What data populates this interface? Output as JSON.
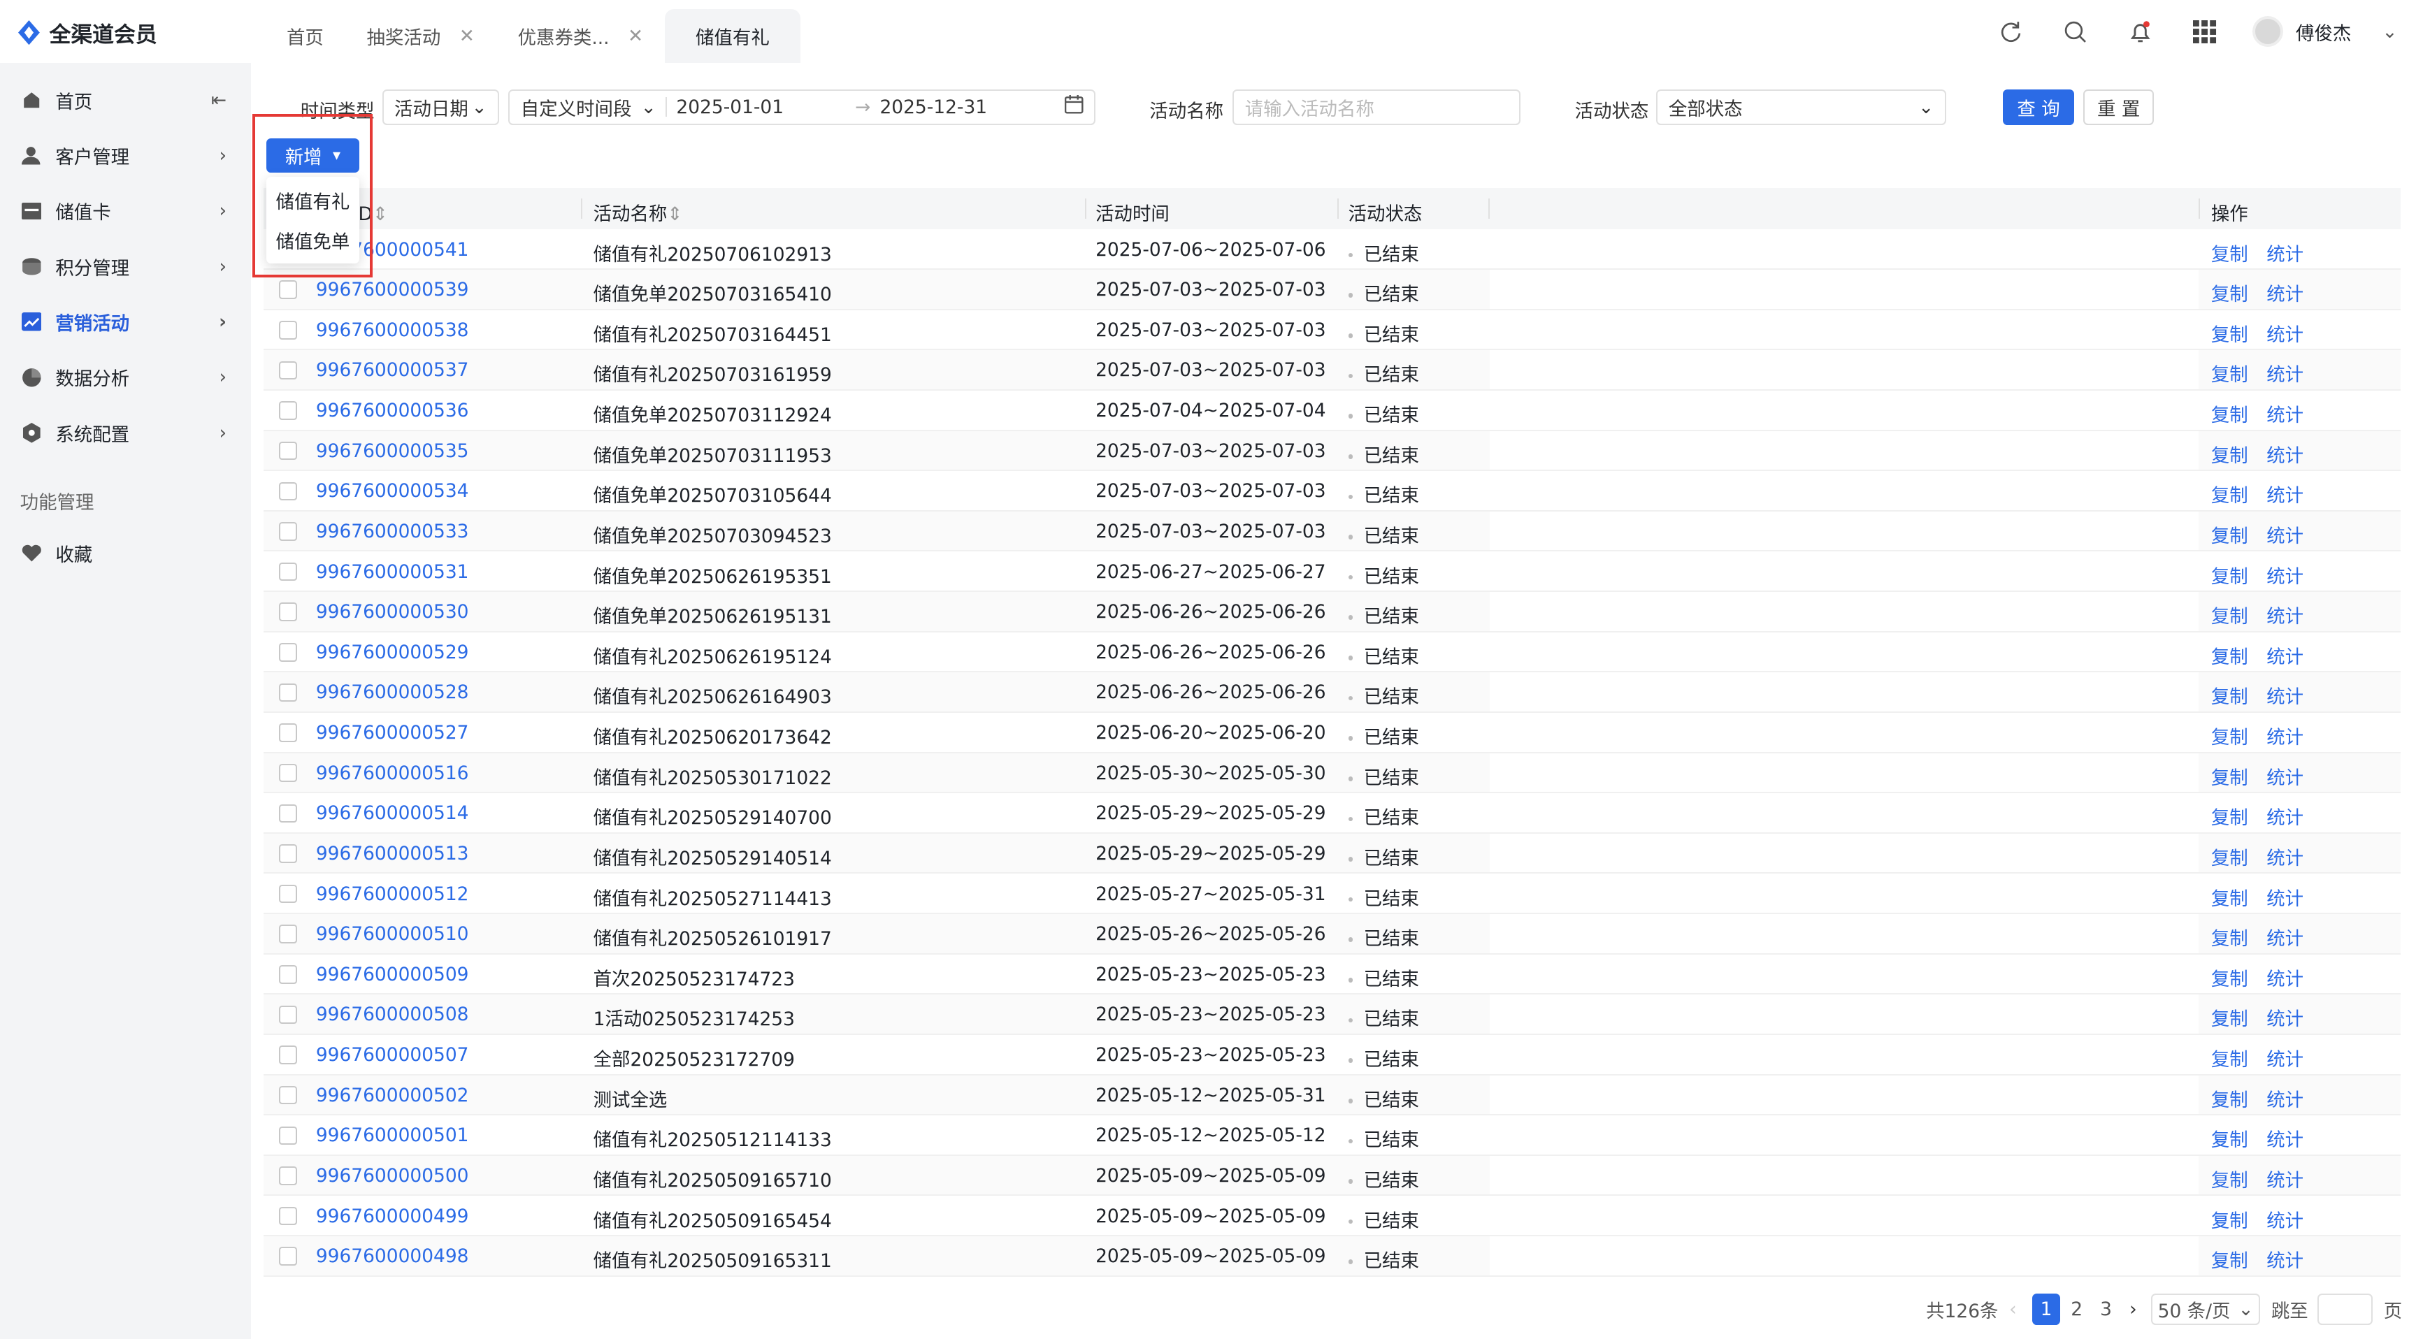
{
  "app": {
    "title": "全渠道会员"
  },
  "tabs": [
    {
      "label": "首页"
    },
    {
      "label": "抽奖活动"
    },
    {
      "label": "优惠券类..."
    },
    {
      "label": "储值有礼"
    }
  ],
  "user": {
    "name": "傅俊杰"
  },
  "sidebar": {
    "items": [
      {
        "label": "首页",
        "icon": "home-icon"
      },
      {
        "label": "客户管理",
        "icon": "user-icon"
      },
      {
        "label": "储值卡",
        "icon": "card-icon"
      },
      {
        "label": "积分管理",
        "icon": "coin-icon"
      },
      {
        "label": "营销活动",
        "icon": "chart-icon"
      },
      {
        "label": "数据分析",
        "icon": "pie-icon"
      },
      {
        "label": "系统配置",
        "icon": "settings-icon"
      }
    ],
    "section": "功能管理",
    "favorite": "收藏"
  },
  "filters": {
    "time_type_label": "时间类型",
    "time_type_value": "活动日期",
    "range_type_value": "自定义时间段",
    "date_start": "2025-01-01",
    "date_end": "2025-12-31",
    "name_label": "活动名称",
    "name_placeholder": "请输入活动名称",
    "status_label": "活动状态",
    "status_value": "全部状态",
    "query_button": "查 询",
    "reset_button": "重 置"
  },
  "actions": {
    "add_button": "新增",
    "add_menu": [
      "储值有礼",
      "储值免单"
    ]
  },
  "table": {
    "headers": {
      "id": "活动ID",
      "name": "活动名称",
      "time": "活动时间",
      "status": "活动状态",
      "ops": "操作"
    },
    "copy_label": "复制",
    "stat_label": "统计",
    "rows": [
      {
        "id": "9967600000541",
        "name": "储值有礼20250706102913",
        "time": "2025-07-06~2025-07-06",
        "status": "已结束"
      },
      {
        "id": "9967600000539",
        "name": "储值免单20250703165410",
        "time": "2025-07-03~2025-07-03",
        "status": "已结束"
      },
      {
        "id": "9967600000538",
        "name": "储值有礼20250703164451",
        "time": "2025-07-03~2025-07-03",
        "status": "已结束"
      },
      {
        "id": "9967600000537",
        "name": "储值有礼20250703161959",
        "time": "2025-07-03~2025-07-03",
        "status": "已结束"
      },
      {
        "id": "9967600000536",
        "name": "储值免单20250703112924",
        "time": "2025-07-04~2025-07-04",
        "status": "已结束"
      },
      {
        "id": "9967600000535",
        "name": "储值免单20250703111953",
        "time": "2025-07-03~2025-07-03",
        "status": "已结束"
      },
      {
        "id": "9967600000534",
        "name": "储值免单20250703105644",
        "time": "2025-07-03~2025-07-03",
        "status": "已结束"
      },
      {
        "id": "9967600000533",
        "name": "储值免单20250703094523",
        "time": "2025-07-03~2025-07-03",
        "status": "已结束"
      },
      {
        "id": "9967600000531",
        "name": "储值免单20250626195351",
        "time": "2025-06-27~2025-06-27",
        "status": "已结束"
      },
      {
        "id": "9967600000530",
        "name": "储值免单20250626195131",
        "time": "2025-06-26~2025-06-26",
        "status": "已结束"
      },
      {
        "id": "9967600000529",
        "name": "储值有礼20250626195124",
        "time": "2025-06-26~2025-06-26",
        "status": "已结束"
      },
      {
        "id": "9967600000528",
        "name": "储值有礼20250626164903",
        "time": "2025-06-26~2025-06-26",
        "status": "已结束"
      },
      {
        "id": "9967600000527",
        "name": "储值有礼20250620173642",
        "time": "2025-06-20~2025-06-20",
        "status": "已结束"
      },
      {
        "id": "9967600000516",
        "name": "储值有礼20250530171022",
        "time": "2025-05-30~2025-05-30",
        "status": "已结束"
      },
      {
        "id": "9967600000514",
        "name": "储值有礼20250529140700",
        "time": "2025-05-29~2025-05-29",
        "status": "已结束"
      },
      {
        "id": "9967600000513",
        "name": "储值有礼20250529140514",
        "time": "2025-05-29~2025-05-29",
        "status": "已结束"
      },
      {
        "id": "9967600000512",
        "name": "储值有礼20250527114413",
        "time": "2025-05-27~2025-05-31",
        "status": "已结束"
      },
      {
        "id": "9967600000510",
        "name": "储值有礼20250526101917",
        "time": "2025-05-26~2025-05-26",
        "status": "已结束"
      },
      {
        "id": "9967600000509",
        "name": "首次20250523174723",
        "time": "2025-05-23~2025-05-23",
        "status": "已结束"
      },
      {
        "id": "9967600000508",
        "name": "1活动0250523174253",
        "time": "2025-05-23~2025-05-23",
        "status": "已结束"
      },
      {
        "id": "9967600000507",
        "name": "全部20250523172709",
        "time": "2025-05-23~2025-05-23",
        "status": "已结束"
      },
      {
        "id": "9967600000502",
        "name": "测试全选",
        "time": "2025-05-12~2025-05-31",
        "status": "已结束"
      },
      {
        "id": "9967600000501",
        "name": "储值有礼20250512114133",
        "time": "2025-05-12~2025-05-12",
        "status": "已结束"
      },
      {
        "id": "9967600000500",
        "name": "储值有礼20250509165710",
        "time": "2025-05-09~2025-05-09",
        "status": "已结束"
      },
      {
        "id": "9967600000499",
        "name": "储值有礼20250509165454",
        "time": "2025-05-09~2025-05-09",
        "status": "已结束"
      },
      {
        "id": "9967600000498",
        "name": "储值有礼20250509165311",
        "time": "2025-05-09~2025-05-09",
        "status": "已结束"
      }
    ]
  },
  "pagination": {
    "total": "共126条",
    "pages": [
      "1",
      "2",
      "3"
    ],
    "current": "1",
    "page_size": "50 条/页",
    "jump_label": "跳至",
    "page_unit": "页"
  },
  "colors": {
    "accent": "#2b6be6",
    "highlight": "#e53935",
    "sidebar_bg": "#f3f4f6"
  }
}
